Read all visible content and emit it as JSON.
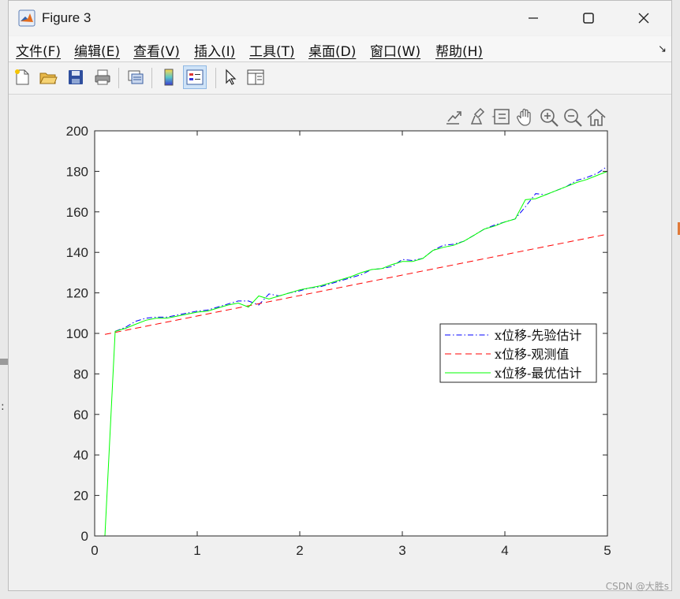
{
  "window": {
    "title": "Figure 3",
    "controls": [
      "—",
      "☐",
      "✕"
    ]
  },
  "menu": {
    "items": [
      "文件(F)",
      "编辑(E)",
      "查看(V)",
      "插入(I)",
      "工具(T)",
      "桌面(D)",
      "窗口(W)",
      "帮助(H)"
    ]
  },
  "toolbar": {
    "icons": [
      "new-figure-icon",
      "open-file-icon",
      "save-icon",
      "print-icon",
      "print-preview-icon",
      "colorbar-icon",
      "legend-icon",
      "pointer-icon",
      "property-inspector-icon"
    ]
  },
  "axes_toolbar": {
    "icons": [
      "export-icon",
      "brush-icon",
      "data-tips-icon",
      "pan-icon",
      "zoom-in-icon",
      "zoom-out-icon",
      "home-icon"
    ]
  },
  "colors": {
    "prior": "#0000ff",
    "observed": "#ff0000",
    "optimal": "#00ff00"
  },
  "watermark": "CSDN @大胜s",
  "chart_data": {
    "type": "line",
    "title": "",
    "xlabel": "",
    "ylabel": "",
    "xlim": [
      0,
      5
    ],
    "ylim": [
      0,
      200
    ],
    "xticks": [
      "0",
      "1",
      "2",
      "3",
      "4",
      "5"
    ],
    "yticks": [
      "0",
      "20",
      "40",
      "60",
      "80",
      "100",
      "120",
      "140",
      "160",
      "180",
      "200"
    ],
    "legend_position": "right",
    "grid": false,
    "series": [
      {
        "name": "x位移-先验估计",
        "style": "dash-dot",
        "color": "#0000ff",
        "x": [
          0.2,
          0.3,
          0.4,
          0.5,
          0.6,
          0.7,
          0.8,
          0.9,
          1.0,
          1.1,
          1.2,
          1.3,
          1.4,
          1.5,
          1.6,
          1.7,
          1.8,
          1.9,
          2.0,
          2.1,
          2.2,
          2.3,
          2.4,
          2.5,
          2.6,
          2.7,
          2.8,
          2.9,
          3.0,
          3.1,
          3.2,
          3.3,
          3.4,
          3.5,
          3.6,
          3.7,
          3.8,
          3.9,
          4.0,
          4.1,
          4.2,
          4.3,
          4.4,
          4.5,
          4.6,
          4.7,
          4.8,
          4.9,
          5.0
        ],
        "y": [
          101,
          103,
          106,
          107.5,
          108,
          108,
          109,
          110,
          111,
          111.5,
          113,
          114.5,
          116,
          116,
          114,
          119.5,
          118.5,
          120,
          121,
          122.5,
          123,
          124.5,
          126,
          127.5,
          129,
          131.5,
          132,
          133,
          136.5,
          136,
          137,
          141,
          143.5,
          144,
          145.5,
          148.5,
          151.5,
          153.5,
          155,
          156.5,
          162.5,
          169,
          168.5,
          170.5,
          172.5,
          175.5,
          177,
          179,
          182.5
        ]
      },
      {
        "name": "x位移-观测值",
        "style": "dashed",
        "color": "#ff0000",
        "x": [
          0.1,
          5.0
        ],
        "y": [
          99.5,
          149
        ]
      },
      {
        "name": "x位移-最优估计",
        "style": "solid",
        "color": "#00ff00",
        "x": [
          0.1,
          0.2,
          0.3,
          0.4,
          0.5,
          0.6,
          0.7,
          0.8,
          0.9,
          1.0,
          1.1,
          1.2,
          1.3,
          1.4,
          1.5,
          1.6,
          1.7,
          1.8,
          1.9,
          2.0,
          2.1,
          2.2,
          2.3,
          2.4,
          2.5,
          2.6,
          2.7,
          2.8,
          2.9,
          3.0,
          3.1,
          3.2,
          3.3,
          3.4,
          3.5,
          3.6,
          3.7,
          3.8,
          3.9,
          4.0,
          4.1,
          4.2,
          4.3,
          4.4,
          4.5,
          4.6,
          4.7,
          4.8,
          4.9,
          5.0
        ],
        "y": [
          0,
          101,
          102.5,
          104.5,
          106.5,
          107.5,
          107.5,
          108.5,
          109.5,
          110.5,
          111,
          112.5,
          114,
          115,
          113,
          118.5,
          117,
          118.5,
          120,
          121.5,
          122.5,
          123.5,
          125,
          126.5,
          128,
          130,
          131.5,
          132,
          134,
          135.5,
          135.5,
          137,
          141,
          142.5,
          143.5,
          145.5,
          148.5,
          151.5,
          153,
          155,
          156.5,
          166,
          166.5,
          168.5,
          170.5,
          172.5,
          174.5,
          176,
          178,
          180
        ]
      }
    ]
  }
}
